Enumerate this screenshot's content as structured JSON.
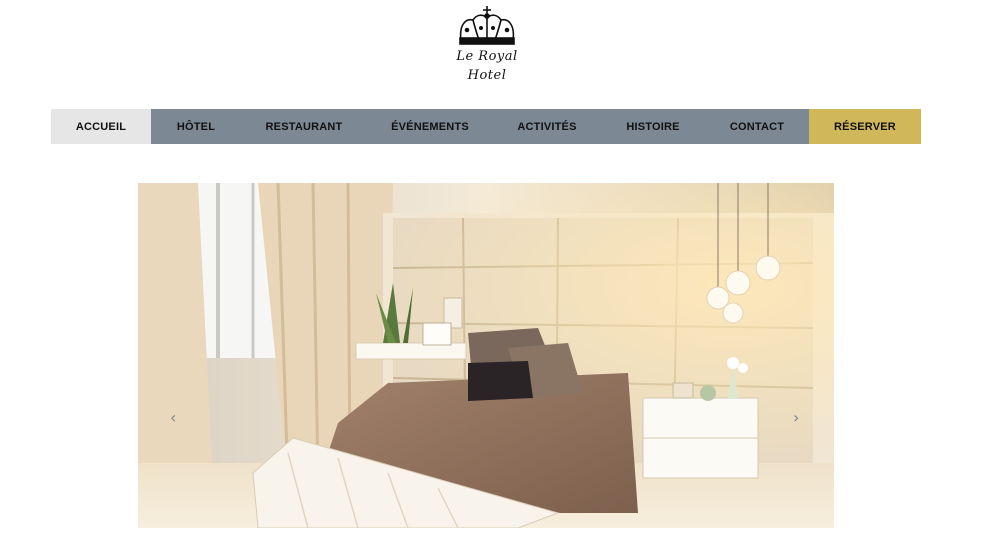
{
  "brand": {
    "line1": "Le Royal",
    "line2": "Hotel",
    "logo_icon": "crown-icon"
  },
  "nav": {
    "items": [
      {
        "label": "ACCUEIL",
        "active": true
      },
      {
        "label": "HÔTEL"
      },
      {
        "label": "RESTAURANT"
      },
      {
        "label": "ÉVÉNEMENTS"
      },
      {
        "label": "ACTIVITÉS"
      },
      {
        "label": "HISTOIRE"
      },
      {
        "label": "CONTACT"
      },
      {
        "label": "RÉSERVER",
        "highlight": true
      }
    ],
    "colors": {
      "bar": "#7c8893",
      "active": "#e6e6e6",
      "reserve": "#cfb75a"
    }
  },
  "slider": {
    "prev_icon": "chevron-left-icon",
    "next_icon": "chevron-right-icon",
    "prev_symbol": "‹",
    "next_symbol": "›",
    "image_subject": "hotel-bedroom"
  }
}
